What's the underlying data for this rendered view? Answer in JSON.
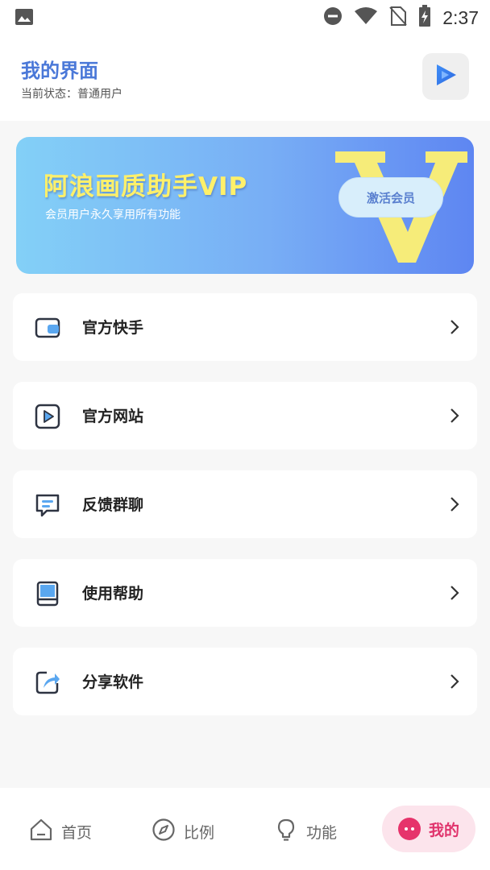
{
  "status_bar": {
    "time": "2:37",
    "icons": [
      "gallery-icon",
      "dnd-icon",
      "wifi-icon",
      "no-sim-icon",
      "battery-charging-icon"
    ]
  },
  "header": {
    "title": "我的界面",
    "subtitle": "当前状态：普通用户",
    "action_icon": "play-icon"
  },
  "vip_banner": {
    "title": "阿浪画质助手VIP",
    "subtitle": "会员用户永久享用所有功能",
    "button_label": "激活会员",
    "colors": {
      "title": "#fff06a",
      "gradient_start": "#83d0f7",
      "gradient_end": "#5e86f2"
    }
  },
  "menu": {
    "items": [
      {
        "label": "官方快手",
        "icon": "wallet-icon"
      },
      {
        "label": "官方网站",
        "icon": "video-play-icon"
      },
      {
        "label": "反馈群聊",
        "icon": "chat-icon"
      },
      {
        "label": "使用帮助",
        "icon": "book-icon"
      },
      {
        "label": "分享软件",
        "icon": "share-icon"
      }
    ]
  },
  "bottom_nav": {
    "items": [
      {
        "label": "首页",
        "icon": "home-icon"
      },
      {
        "label": "比例",
        "icon": "compass-icon"
      },
      {
        "label": "功能",
        "icon": "bulb-icon"
      },
      {
        "label": "我的",
        "icon": "profile-dot-icon",
        "active": true
      }
    ],
    "active_color": "#e0336c"
  }
}
